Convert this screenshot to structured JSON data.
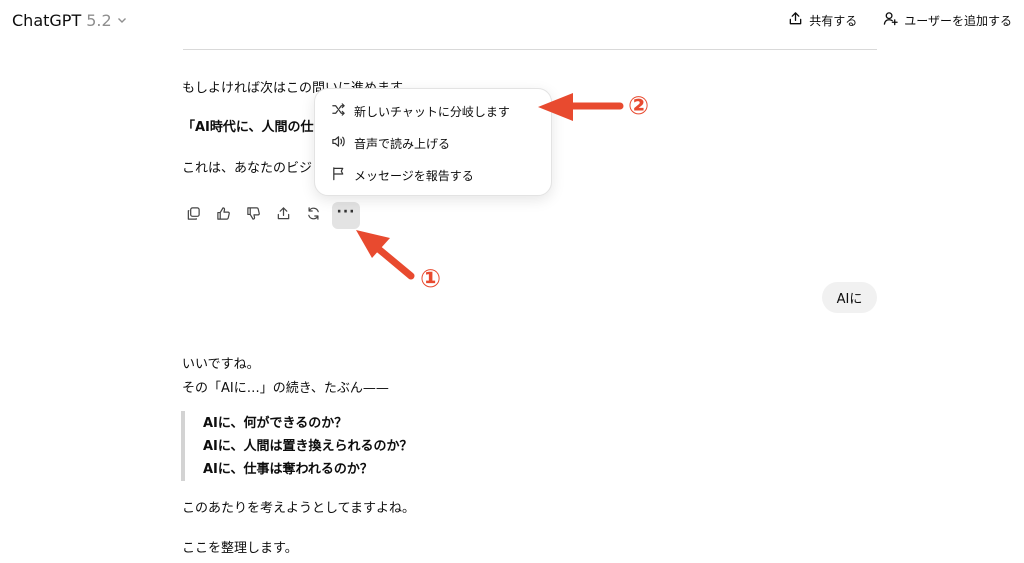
{
  "header": {
    "model_name": "ChatGPT",
    "model_version": "5.2",
    "share_label": "共有する",
    "add_user_label": "ユーザーを追加する"
  },
  "message1": {
    "line1": "もしよければ次はこの問いに進めます",
    "line2_bold": "「AI時代に、人間の仕",
    "line3": "これは、あなたのビジ"
  },
  "menu": {
    "items": [
      {
        "label": "新しいチャットに分岐します",
        "icon": "branch-icon"
      },
      {
        "label": "音声で読み上げる",
        "icon": "speaker-icon"
      },
      {
        "label": "メッセージを報告する",
        "icon": "flag-icon"
      }
    ]
  },
  "user_bubble": "AIに",
  "message2": {
    "line1": "いいですね。",
    "line2": "その「AIに…」の続き、たぶん——",
    "quote": [
      "AIに、何ができるのか？",
      "AIに、人間は置き換えられるのか？",
      "AIに、仕事は奪われるのか？"
    ],
    "line3": "このあたりを考えようとしてますよね。",
    "line4": "ここを整理します。"
  },
  "annotations": {
    "one": "①",
    "two": "②",
    "color": "#e84a2f"
  }
}
